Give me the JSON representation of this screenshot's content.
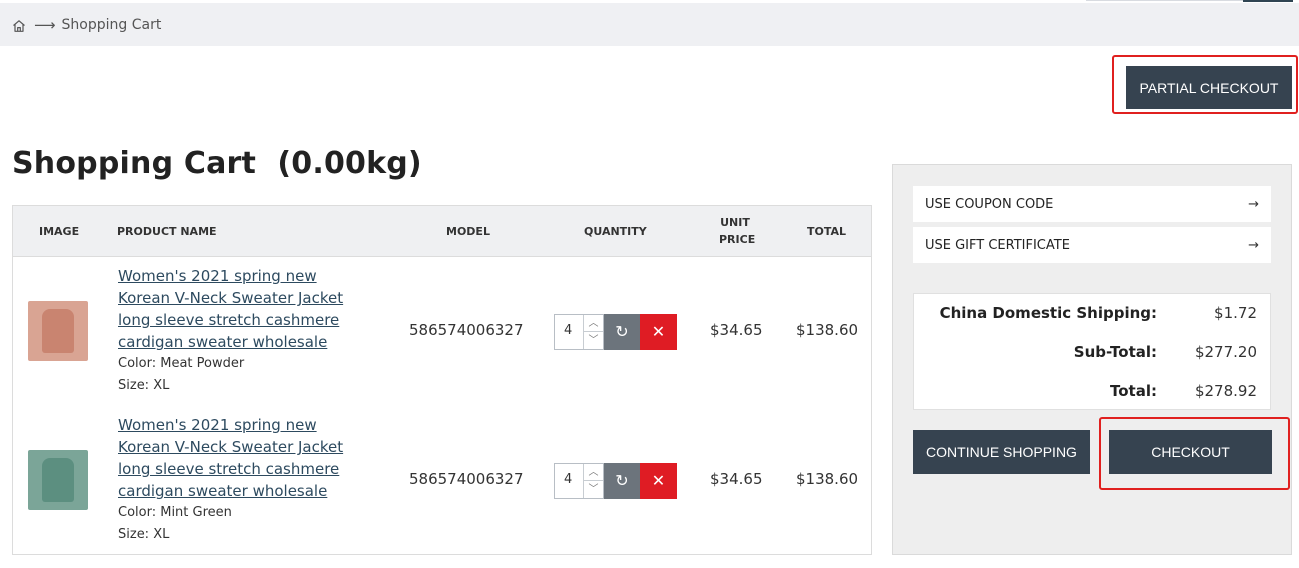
{
  "breadcrumb": {
    "home_icon": "home-icon",
    "separator": "⟶",
    "current": "Shopping Cart"
  },
  "actions": {
    "partial_checkout": "PARTIAL CHECKOUT",
    "continue_shopping": "CONTINUE SHOPPING",
    "checkout": "CHECKOUT"
  },
  "cart": {
    "title": "Shopping Cart  (0.00kg)",
    "columns": {
      "image": "IMAGE",
      "product_name": "PRODUCT NAME",
      "model": "MODEL",
      "quantity": "QUANTITY",
      "unit_price_line1": "UNIT",
      "unit_price_line2": "PRICE",
      "total": "TOTAL"
    },
    "items": [
      {
        "name": "Women's 2021 spring new Korean V-Neck Sweater Jacket long sleeve stretch cashmere cardigan sweater wholesale",
        "color": "Color: Meat Powder",
        "size": "Size: XL",
        "model": "586574006327",
        "quantity": "4",
        "unit_price": "$34.65",
        "total": "$138.60"
      },
      {
        "name": "Women's 2021 spring new Korean V-Neck Sweater Jacket long sleeve stretch cashmere cardigan sweater wholesale",
        "color": "Color: Mint Green",
        "size": "Size: XL",
        "model": "586574006327",
        "quantity": "4",
        "unit_price": "$34.65",
        "total": "$138.60"
      }
    ]
  },
  "side": {
    "coupon": "USE COUPON CODE",
    "gift": "USE GIFT CERTIFICATE",
    "arrow": "→",
    "totals": [
      {
        "label": "China Domestic Shipping:",
        "value": "$1.72"
      },
      {
        "label": "Sub-Total:",
        "value": "$277.20"
      },
      {
        "label": "Total:",
        "value": "$278.92"
      }
    ]
  },
  "icons": {
    "refresh": "↻",
    "remove": "✕",
    "spin_up": "︿",
    "spin_down": "﹀"
  },
  "colors": {
    "button_dark": "#364350",
    "remove_red": "#df1c24",
    "highlight_red": "#e0201f",
    "link_blue": "#2d4a5f"
  }
}
